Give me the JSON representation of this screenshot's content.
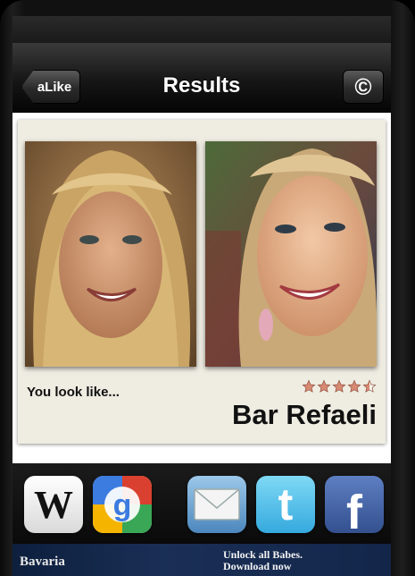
{
  "navbar": {
    "title": "Results",
    "back_label": "aLike",
    "copyright_symbol": "©"
  },
  "result": {
    "intro_text": "You look like...",
    "match_name": "Bar Refaeli",
    "rating_stars": 4.5,
    "rating_max": 5
  },
  "share": {
    "items": [
      {
        "name": "wikipedia",
        "glyph": "W"
      },
      {
        "name": "google",
        "glyph": "g"
      },
      {
        "name": "email",
        "glyph": "✉"
      },
      {
        "name": "twitter",
        "glyph": "t"
      },
      {
        "name": "facebook",
        "glyph": "f"
      }
    ]
  },
  "ad": {
    "brand": "Bavaria",
    "line1": "Unlock all Babes.",
    "line2": "Download now"
  },
  "colors": {
    "card_bg": "#efece2",
    "star_fill": "#d98a73",
    "facebook_blue": "#3b5998",
    "twitter_blue": "#35a9de"
  }
}
